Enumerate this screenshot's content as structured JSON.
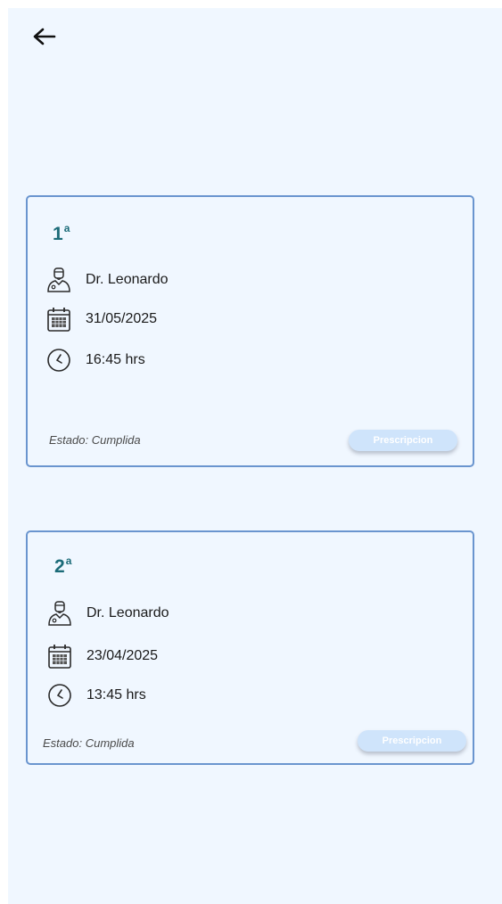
{
  "header": {
    "back_icon": "arrow-left-icon"
  },
  "appointments": [
    {
      "number": "1",
      "ordinal_suffix": "a",
      "doctor": "Dr. Leonardo",
      "date": "31/05/2025",
      "time": "16:45 hrs",
      "status": "Estado: Cumplida",
      "action_label": "Prescripcion"
    },
    {
      "number": "2",
      "ordinal_suffix": "a",
      "doctor": "Dr. Leonardo",
      "date": "23/04/2025",
      "time": "13:45 hrs",
      "status": "Estado: Cumplida",
      "action_label": "Prescripcion"
    }
  ],
  "icons": {
    "doctor": "doctor-icon",
    "date": "calendar-icon",
    "time": "clock-icon"
  },
  "colors": {
    "background": "#f0f7ff",
    "card_border": "#6a95cf",
    "ordinal": "#1b6b78",
    "button_bg": "#cfe4fb"
  }
}
